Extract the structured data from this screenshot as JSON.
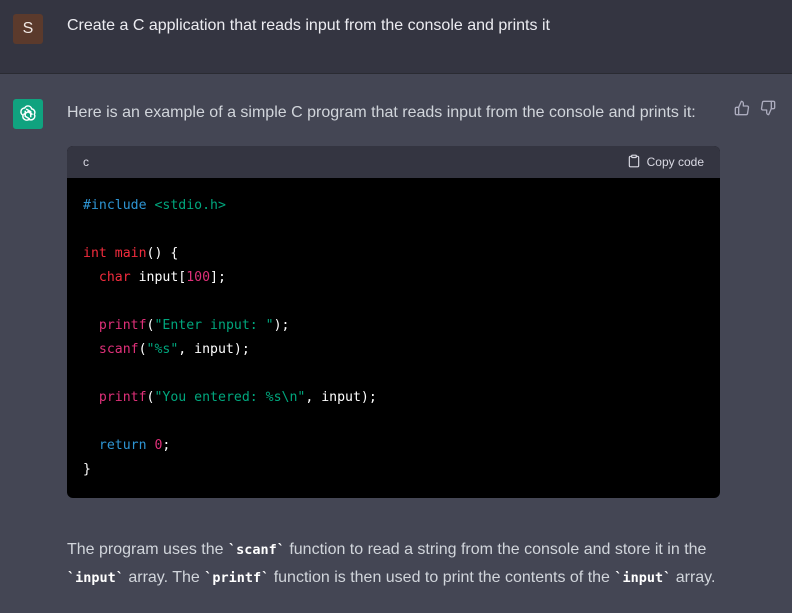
{
  "user": {
    "avatar_letter": "S",
    "message": "Create a C application that reads input from the console and prints it"
  },
  "assistant": {
    "avatar_icon": "openai-logo-icon",
    "intro": "Here is an example of a simple C program that reads input from the console and prints it:",
    "code_block": {
      "language": "c",
      "copy_label": "Copy code",
      "lines": {
        "l1_pre": "#include",
        "l1_inc": " <stdio.h>",
        "l3_type": "int",
        "l3_fn": " main",
        "l3_rest": "() {",
        "l4_type": "  char",
        "l4_rest": " input[",
        "l4_num": "100",
        "l4_end": "];",
        "l6_call": "  printf",
        "l6_p1": "(",
        "l6_str": "\"Enter input: \"",
        "l6_end": ");",
        "l7_call": "  scanf",
        "l7_p1": "(",
        "l7_str": "\"%s\"",
        "l7_end": ", input);",
        "l9_call": "  printf",
        "l9_p1": "(",
        "l9_str": "\"You entered: %s\\n\"",
        "l9_end": ", input);",
        "l11_kw": "  return",
        "l11_num": " 0",
        "l11_end": ";",
        "l12": "}"
      }
    },
    "outro": {
      "t1": "The program uses the ",
      "c1": "`scanf`",
      "t2": " function to read a string from the console and store it in the ",
      "c2": "`input`",
      "t3": " array. The ",
      "c3": "`printf`",
      "t4": " function is then used to print the contents of the ",
      "c4": "`input`",
      "t5": " array."
    }
  },
  "colors": {
    "user_bg": "#343541",
    "assistant_bg": "#444654",
    "bot_avatar": "#10a37f",
    "user_avatar": "#5b3a2c"
  }
}
